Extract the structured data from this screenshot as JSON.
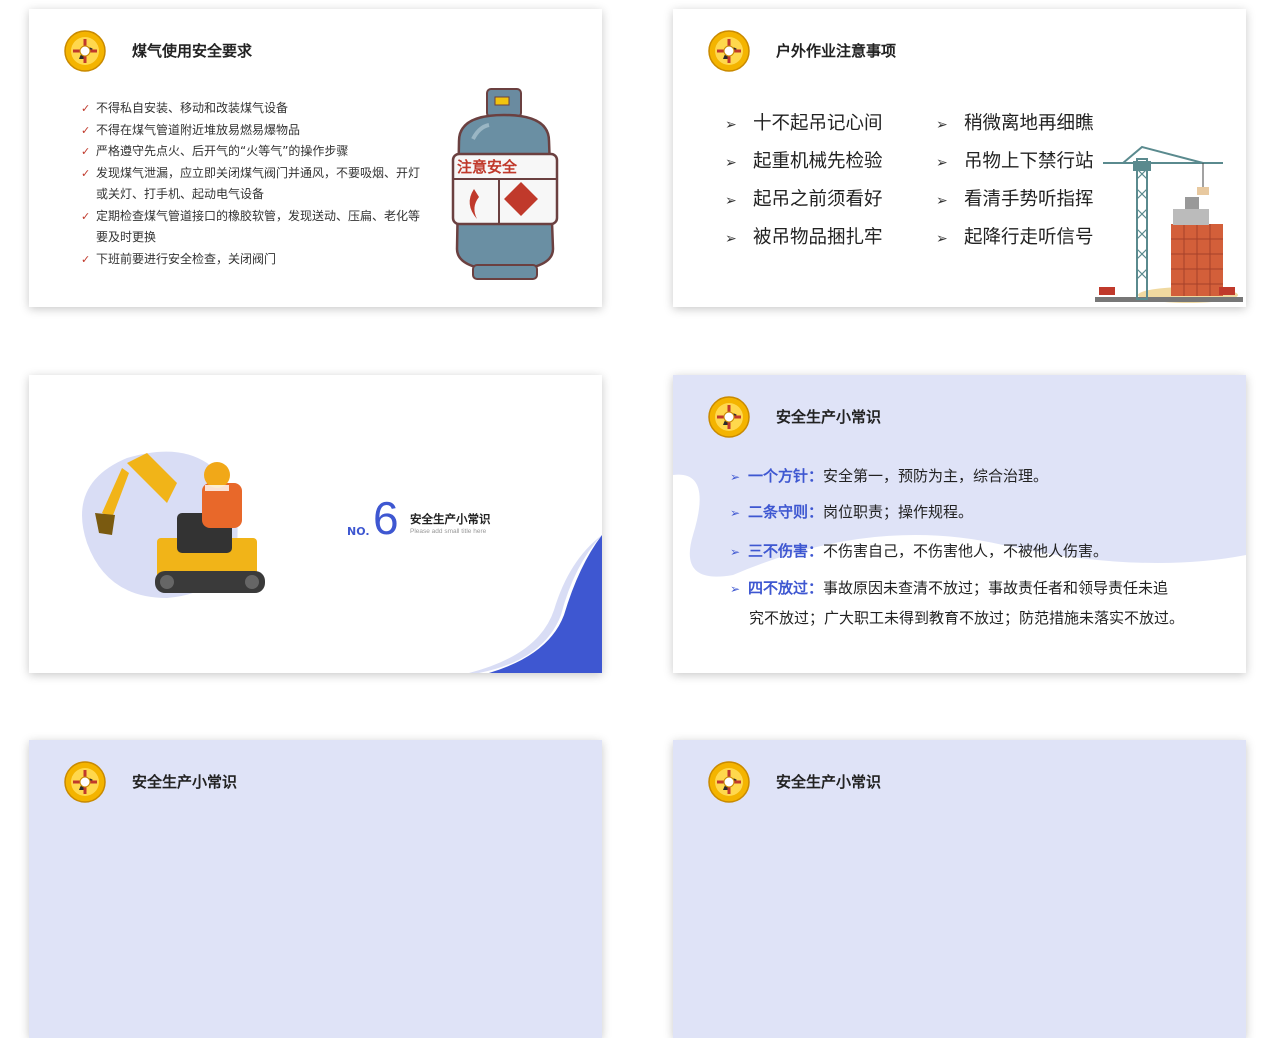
{
  "colors": {
    "accent": "#3e57d1",
    "lavender": "#dfe3f7",
    "check_red": "#c0392b"
  },
  "slide1": {
    "title": "煤气使用安全要求",
    "items": [
      "不得私自安装、移动和改装煤气设备",
      "不得在煤气管道附近堆放易燃易爆物品",
      "严格遵守先点火、后开气的“火等气”的操作步骤",
      "发现煤气泄漏，应立即关闭煤气阀门并通风，不要吸烟、开灯或关灯、打手机、起动电气设备",
      "定期检查煤气管道接口的橡胶软管，发现送动、压扁、老化等要及时更换",
      "下班前要进行安全检查，关闭阀门"
    ],
    "tank_label": "注意安全"
  },
  "slide2": {
    "title": "户外作业注意事项",
    "left": [
      "十不起吊记心间",
      "起重机械先检验",
      "起吊之前须看好",
      "被吊物品捆扎牢"
    ],
    "right": [
      "稍微离地再细瞧",
      "吊物上下禁行站",
      "看清手势听指挥",
      "起降行走听信号"
    ]
  },
  "slide3": {
    "no_label": "NO.",
    "number": "6",
    "title": "安全生产小常识",
    "subtitle": "Please add small title here"
  },
  "slide4": {
    "title": "安全生产小常识",
    "facts": [
      {
        "kw": "一个方针：",
        "text": "安全第一，预防为主，综合治理。",
        "cont": ""
      },
      {
        "kw": "二条守则：",
        "text": "岗位职责；操作规程。",
        "cont": ""
      },
      {
        "kw": "三不伤害：",
        "text": "不伤害自己，不伤害他人，不被他人伤害。",
        "cont": ""
      },
      {
        "kw": "四不放过：",
        "text": "事故原因未查清不放过；事故责任者和领导责任未追",
        "cont": "究不放过；广大职工未得到教育不放过；防范措施未落实不放过。"
      }
    ]
  },
  "slide5": {
    "title": "安全生产小常识"
  },
  "slide6": {
    "title": "安全生产小常识"
  }
}
